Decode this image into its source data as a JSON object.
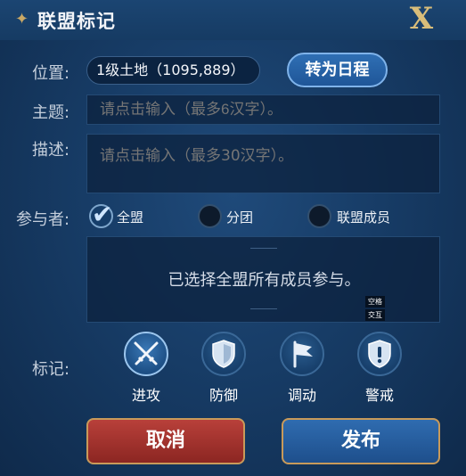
{
  "title": "联盟标记",
  "close_label": "X",
  "location": {
    "label": "位置:",
    "value": "1级土地（1095,889）",
    "schedule_button": "转为日程"
  },
  "subject": {
    "label": "主题:",
    "placeholder": "请点击输入（最多6汉字）。"
  },
  "description": {
    "label": "描述:",
    "placeholder": "请点击输入（最多30汉字）。"
  },
  "participants": {
    "label": "参与者:",
    "options": [
      {
        "label": "全盟",
        "selected": true
      },
      {
        "label": "分团",
        "selected": false
      },
      {
        "label": "联盟成员",
        "selected": false
      }
    ],
    "info": "已选择全盟所有成员参与。"
  },
  "tooltips": [
    "空格",
    "交互"
  ],
  "marks": {
    "label": "标记:",
    "items": [
      {
        "label": "进攻",
        "icon": "crossed-swords-icon",
        "active": true
      },
      {
        "label": "防御",
        "icon": "shield-icon",
        "active": false
      },
      {
        "label": "调动",
        "icon": "flag-icon",
        "active": false
      },
      {
        "label": "警戒",
        "icon": "alert-shield-icon",
        "active": false
      }
    ]
  },
  "actions": {
    "cancel": "取消",
    "publish": "发布"
  },
  "colors": {
    "accent_gold": "#c89a5a",
    "cancel_red": "#b8403a",
    "publish_blue": "#2f6cb0"
  }
}
